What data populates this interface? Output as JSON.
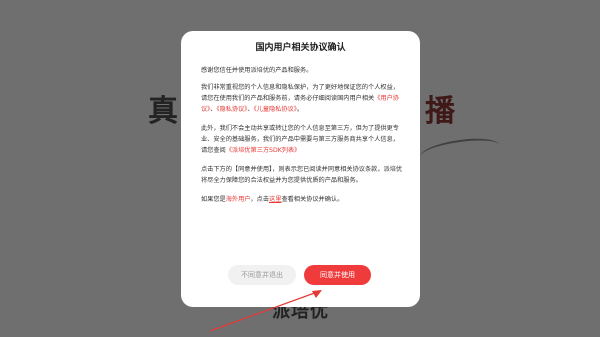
{
  "background": {
    "calli_left": "真",
    "calli_right": "播",
    "logo_text": "派培优"
  },
  "dialog": {
    "title": "国内用户相关协议确认",
    "p1": "感谢您信任并使用派培优的产品和服务。",
    "p2_a": "我们非常重视您的个人信息和隐私保护，为了更好地保证您的个人权益，请您在使用我们的产品和服务前，请务必仔细阅读国内用户相关",
    "p2_link1": "《用户协议》",
    "p2_sep1": "、",
    "p2_link2": "《隐私协议》",
    "p2_sep2": "、",
    "p2_link3": "《儿童隐私协议》",
    "p2_end": "。",
    "p3_a": "此外，我们不会主动共享或转让您的个人信息至第三方，但为了提供更专业、安全的基础服务，我们的产品中需要与第三方服务商共享个人信息，请您查阅",
    "p3_link": "《派培优第三方SDK列表》",
    "p4": "点击下方的【同意并使用】，则表示您已阅读并同意相关协议条款，派培优将尽全力保障您的合法权益并为您提供优质的产品和服务。",
    "p5_a": "如果您是",
    "p5_link1": "海外用户",
    "p5_b": "，点击",
    "p5_link2": "这里",
    "p5_c": "查看相关协议并确认。",
    "decline_label": "不同意并退出",
    "agree_label": "同意并使用"
  },
  "colors": {
    "accent": "#ef3b3b",
    "link": "#e53935"
  }
}
